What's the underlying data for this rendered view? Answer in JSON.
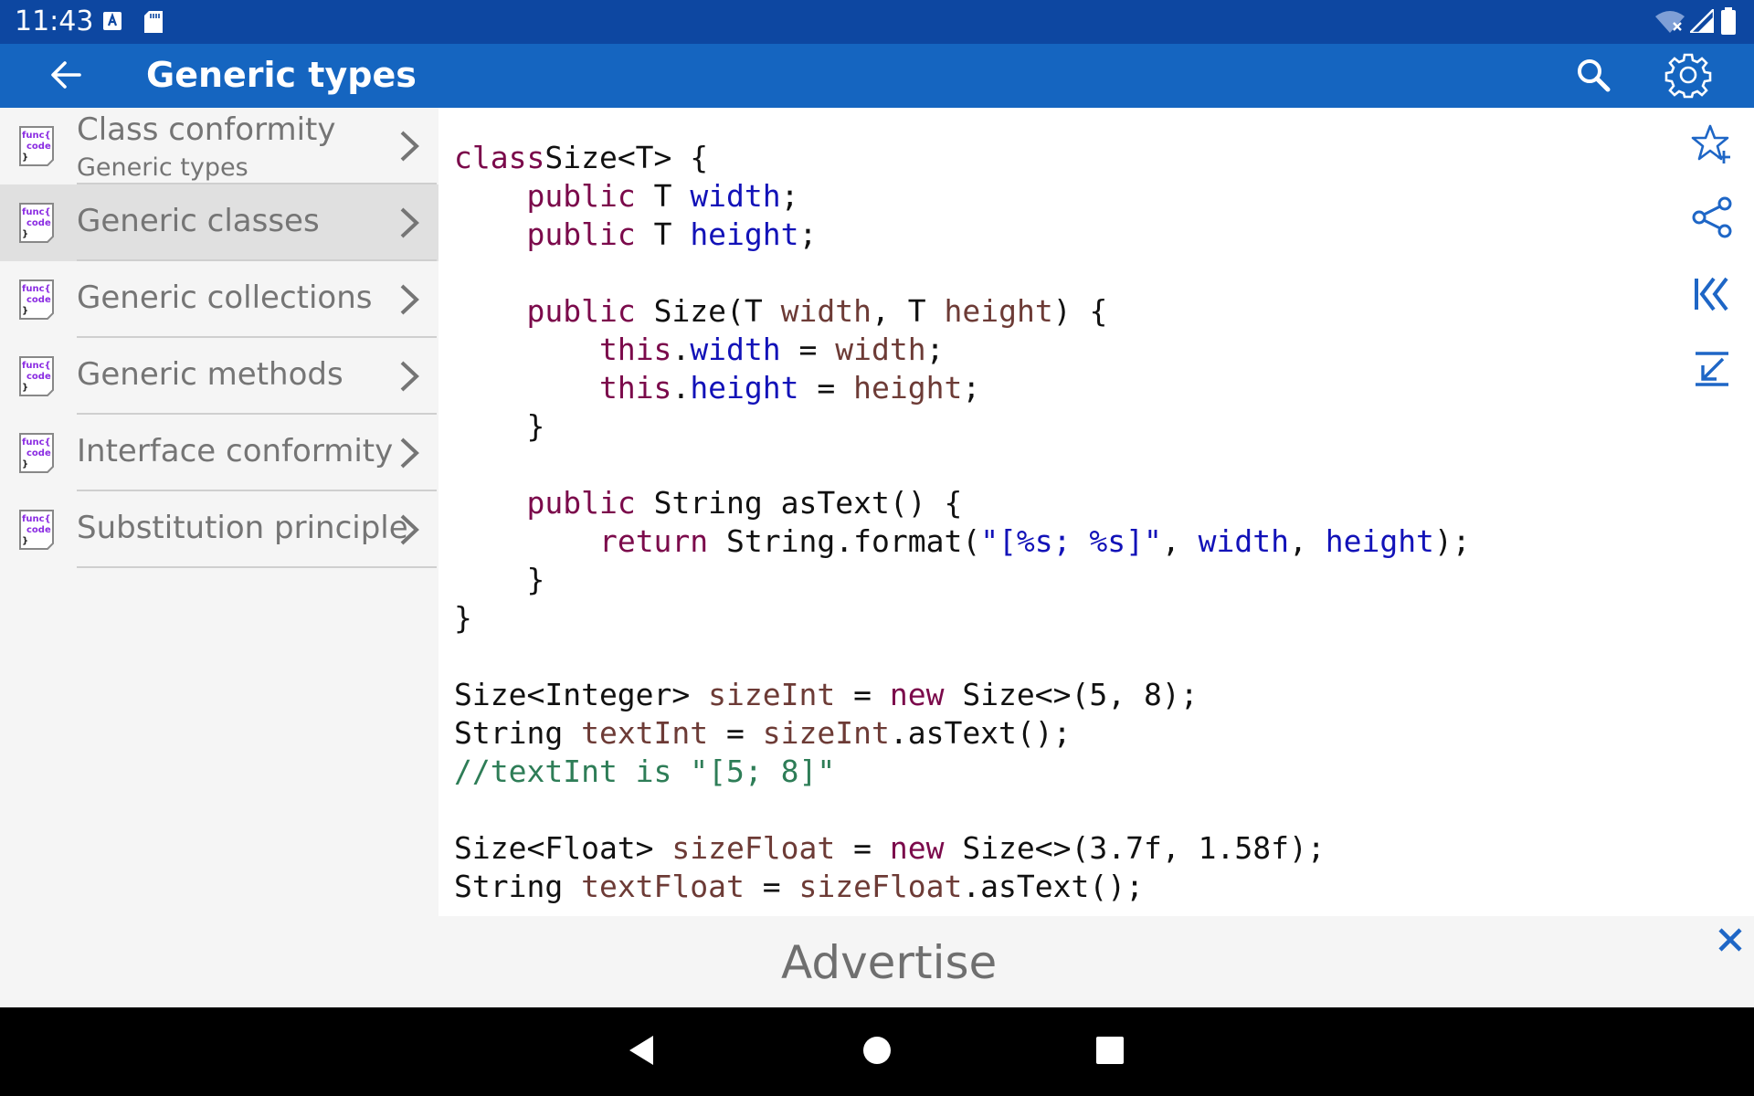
{
  "status_bar": {
    "time": "11:43"
  },
  "app_bar": {
    "title": "Generic types"
  },
  "sidebar": {
    "items": [
      {
        "label": "Class conformity",
        "sublabel": "Generic types",
        "selected": false
      },
      {
        "label": "Generic classes",
        "selected": true
      },
      {
        "label": "Generic collections",
        "selected": false
      },
      {
        "label": "Generic methods",
        "selected": false
      },
      {
        "label": "Interface conformity",
        "selected": false
      },
      {
        "label": "Substitution principle",
        "selected": false
      }
    ],
    "item_icon_text": [
      "func{",
      "code",
      "}"
    ]
  },
  "code": {
    "lines": [
      [
        [
          "kw",
          "class"
        ],
        [
          "",
          "Size<T> {"
        ]
      ],
      [
        [
          "",
          "    "
        ],
        [
          "kw",
          "public"
        ],
        [
          "",
          " T "
        ],
        [
          "fld",
          "width"
        ],
        [
          "",
          ";"
        ]
      ],
      [
        [
          "",
          "    "
        ],
        [
          "kw",
          "public"
        ],
        [
          "",
          " T "
        ],
        [
          "fld",
          "height"
        ],
        [
          "",
          ";"
        ]
      ],
      [],
      [
        [
          "",
          "    "
        ],
        [
          "kw",
          "public"
        ],
        [
          "",
          " Size(T "
        ],
        [
          "var",
          "width"
        ],
        [
          "",
          ", T "
        ],
        [
          "var",
          "height"
        ],
        [
          "",
          ") {"
        ]
      ],
      [
        [
          "",
          "        "
        ],
        [
          "kw",
          "this"
        ],
        [
          "",
          "."
        ],
        [
          "fld",
          "width"
        ],
        [
          "",
          " = "
        ],
        [
          "var",
          "width"
        ],
        [
          "",
          ";"
        ]
      ],
      [
        [
          "",
          "        "
        ],
        [
          "kw",
          "this"
        ],
        [
          "",
          "."
        ],
        [
          "fld",
          "height"
        ],
        [
          "",
          " = "
        ],
        [
          "var",
          "height"
        ],
        [
          "",
          ";"
        ]
      ],
      [
        [
          "",
          "    }"
        ]
      ],
      [],
      [
        [
          "",
          "    "
        ],
        [
          "kw",
          "public"
        ],
        [
          "",
          " String asText() {"
        ]
      ],
      [
        [
          "",
          "        "
        ],
        [
          "kw",
          "return"
        ],
        [
          "",
          " String.format("
        ],
        [
          "str",
          "\"[%s; %s]\""
        ],
        [
          "",
          ", "
        ],
        [
          "fld",
          "width"
        ],
        [
          "",
          ", "
        ],
        [
          "fld",
          "height"
        ],
        [
          "",
          ");"
        ]
      ],
      [
        [
          "",
          "    }"
        ]
      ],
      [
        [
          "",
          "}"
        ]
      ],
      [],
      [
        [
          "",
          "Size<Integer> "
        ],
        [
          "var",
          "sizeInt"
        ],
        [
          "",
          " = "
        ],
        [
          "kw",
          "new"
        ],
        [
          "",
          " Size<>(5, 8);"
        ]
      ],
      [
        [
          "",
          "String "
        ],
        [
          "var",
          "textInt"
        ],
        [
          "",
          " = "
        ],
        [
          "var",
          "sizeInt"
        ],
        [
          "",
          ".asText();"
        ]
      ],
      [
        [
          "cmt",
          "//textInt is \"[5; 8]\""
        ]
      ],
      [],
      [
        [
          "",
          "Size<Float> "
        ],
        [
          "var",
          "sizeFloat"
        ],
        [
          "",
          " = "
        ],
        [
          "kw",
          "new"
        ],
        [
          "",
          " Size<>(3.7f, 1.58f);"
        ]
      ],
      [
        [
          "",
          "String "
        ],
        [
          "var",
          "textFloat"
        ],
        [
          "",
          " = "
        ],
        [
          "var",
          "sizeFloat"
        ],
        [
          "",
          ".asText();"
        ]
      ]
    ]
  },
  "ad": {
    "text": "Advertise"
  },
  "colors": {
    "status_bar": "#0d47a1",
    "app_bar": "#1565c0",
    "accent_icon": "#1e66c6",
    "keyword": "#7b0a4b",
    "field": "#1212b8",
    "variable": "#6d3b36",
    "comment": "#2e7d57"
  },
  "icons": {
    "app_bar": [
      "back-arrow-icon",
      "search-icon",
      "gear-icon"
    ],
    "right_toolbar": [
      "star-add-icon",
      "share-icon",
      "first-page-icon",
      "download-arrow-icon"
    ],
    "nav": [
      "back-triangle-icon",
      "home-circle-icon",
      "recents-square-icon"
    ]
  }
}
